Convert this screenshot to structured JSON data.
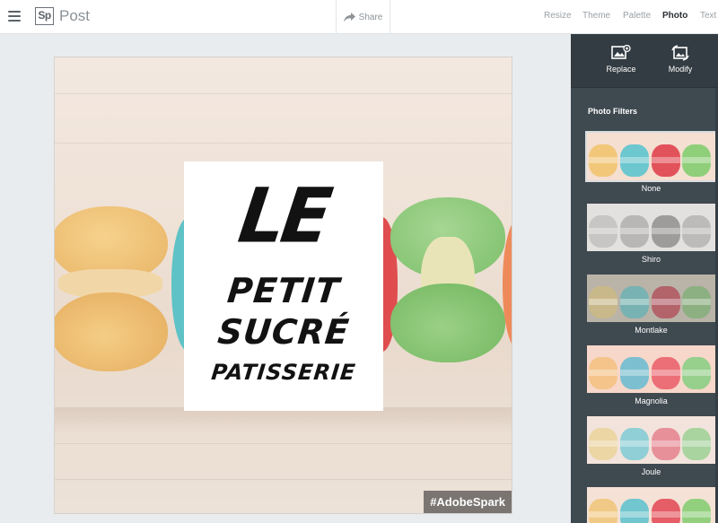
{
  "header": {
    "logo_text": "Sp",
    "app_name": "Post",
    "share_label": "Share",
    "nav": [
      {
        "label": "Resize",
        "active": false
      },
      {
        "label": "Theme",
        "active": false
      },
      {
        "label": "Palette",
        "active": false
      },
      {
        "label": "Photo",
        "active": true
      },
      {
        "label": "Text",
        "active": false
      }
    ]
  },
  "canvas": {
    "text_lines": [
      "LE",
      "PETIT",
      "SUCRÉ",
      "PATISSERIE"
    ],
    "watermark": "#AdobeSpark"
  },
  "panel": {
    "tools": [
      {
        "label": "Replace",
        "icon": "replace-photo-icon"
      },
      {
        "label": "Modify",
        "icon": "modify-photo-icon"
      }
    ],
    "heading": "Photo Filters",
    "filters": [
      {
        "label": "None",
        "selected": true,
        "colors": [
          "#f2c77a",
          "#6cc7cf",
          "#e2525a",
          "#8fcf7a"
        ],
        "bg": "#f4dfd1"
      },
      {
        "label": "Shiro",
        "selected": false,
        "colors": [
          "#c8c6c4",
          "#b9b7b5",
          "#9e9c9a",
          "#bdbbb9"
        ],
        "bg": "#e3e1df"
      },
      {
        "label": "Montlake",
        "selected": false,
        "colors": [
          "#c9b98a",
          "#78b2b2",
          "#b3636a",
          "#8db082"
        ],
        "bg": "#b9b3a8"
      },
      {
        "label": "Magnolia",
        "selected": false,
        "colors": [
          "#f4c48a",
          "#7cbfd0",
          "#ec6f78",
          "#97cf8c"
        ],
        "bg": "#f7d7c9"
      },
      {
        "label": "Joule",
        "selected": false,
        "colors": [
          "#ecd6a4",
          "#90cfd6",
          "#e8909a",
          "#a9d4a0"
        ],
        "bg": "#f2e4dc"
      },
      {
        "label": "",
        "selected": false,
        "colors": [
          "#f1c986",
          "#71c6cf",
          "#e55d66",
          "#92d07e"
        ],
        "bg": "#f5e2d6"
      }
    ]
  }
}
